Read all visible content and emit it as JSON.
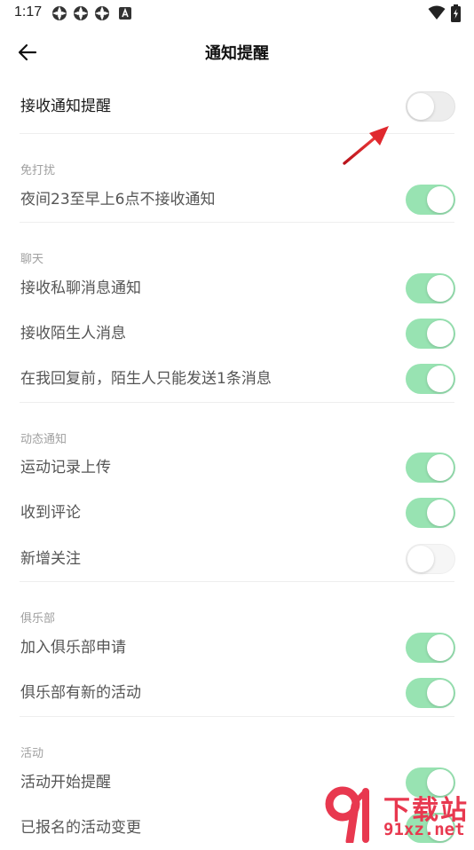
{
  "status_bar": {
    "time": "1:17",
    "icons": [
      "notification-icon",
      "notification-icon",
      "notification-icon",
      "a-icon",
      "wifi-icon",
      "battery-icon"
    ]
  },
  "header": {
    "back_icon": "arrow-left-icon",
    "title": "通知提醒"
  },
  "main_setting": {
    "label": "接收通知提醒",
    "enabled": false
  },
  "sections": [
    {
      "title": "免打扰",
      "items": [
        {
          "label": "夜间23至早上6点不接收通知",
          "enabled": true
        }
      ]
    },
    {
      "title": "聊天",
      "items": [
        {
          "label": "接收私聊消息通知",
          "enabled": true
        },
        {
          "label": "接收陌生人消息",
          "enabled": true
        },
        {
          "label": "在我回复前，陌生人只能发送1条消息",
          "enabled": true
        }
      ]
    },
    {
      "title": "动态通知",
      "items": [
        {
          "label": "运动记录上传",
          "enabled": true
        },
        {
          "label": "收到评论",
          "enabled": true
        },
        {
          "label": "新增关注",
          "enabled": false
        }
      ]
    },
    {
      "title": "俱乐部",
      "items": [
        {
          "label": "加入俱乐部申请",
          "enabled": true
        },
        {
          "label": "俱乐部有新的活动",
          "enabled": true
        }
      ]
    },
    {
      "title": "活动",
      "items": [
        {
          "label": "活动开始提醒",
          "enabled": true
        },
        {
          "label": "已报名的活动变更",
          "enabled": true
        }
      ]
    }
  ],
  "watermark": {
    "line1": "下载站",
    "line2": "91xz.net"
  },
  "colors": {
    "toggle_on": "#98e3b2",
    "toggle_off": "#ededed",
    "annotation_arrow": "#d9262c",
    "watermark": "#e8384f"
  }
}
